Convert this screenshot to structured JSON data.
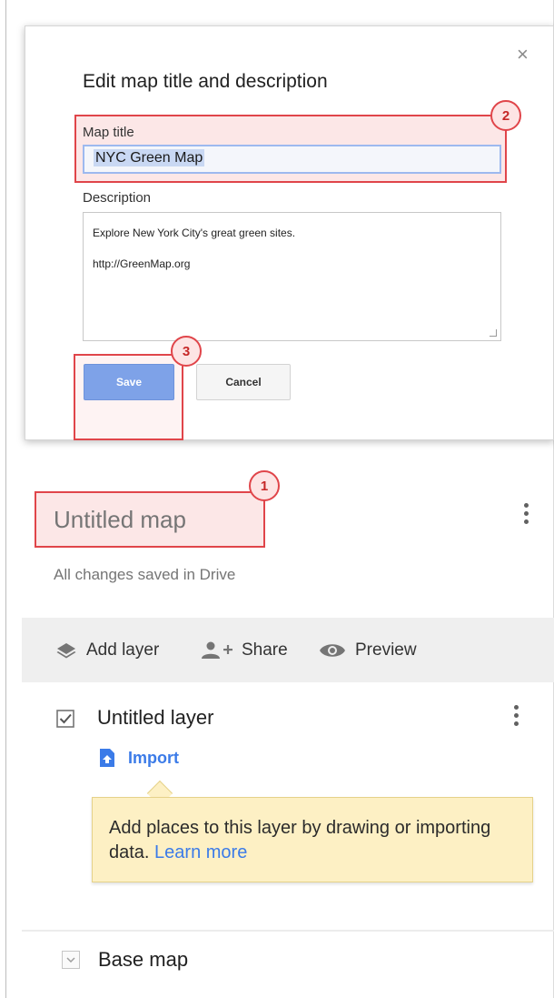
{
  "dialog": {
    "title": "Edit map title and description",
    "close_glyph": "×",
    "map_title_label": "Map title",
    "map_title_value": "NYC Green Map",
    "description_label": "Description",
    "description_lines": [
      "Explore New York City's great green sites.",
      "http://GreenMap.org"
    ],
    "save_label": "Save",
    "cancel_label": "Cancel"
  },
  "callouts": {
    "badge_1": "1",
    "badge_2": "2",
    "badge_3": "3",
    "color": "#e0454a"
  },
  "map": {
    "title": "Untitled map",
    "status": "All changes saved in Drive"
  },
  "toolbar": {
    "add_layer": "Add layer",
    "share": "Share",
    "preview": "Preview"
  },
  "layer": {
    "name": "Untitled layer",
    "checked": true,
    "import_label": "Import",
    "tooltip_text": "Add places to this layer by drawing or importing data.",
    "tooltip_link": "Learn more"
  },
  "base_map": {
    "label": "Base map"
  },
  "colors": {
    "accent_blue": "#3b7be8",
    "save_button": "#7ea2e8",
    "tooltip_bg": "#fdf0c4",
    "toolbar_bg": "#efefef"
  },
  "icons": {
    "close": "close-icon",
    "layers": "layers-icon",
    "share": "person-add-icon",
    "preview": "eye-icon",
    "checkbox": "checkbox-checked-icon",
    "import": "file-upload-icon",
    "menu": "more-vert-icon",
    "expand": "chevron-down-icon"
  }
}
